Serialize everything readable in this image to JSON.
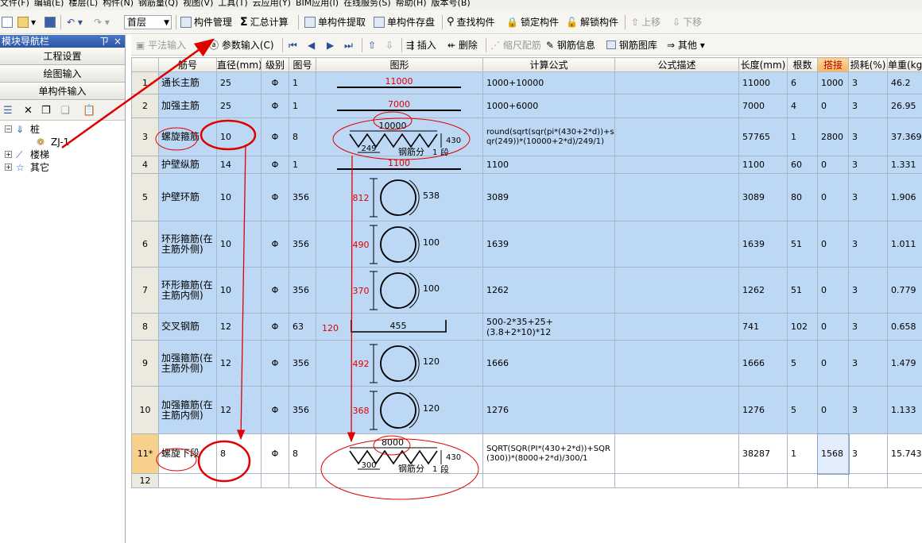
{
  "menu": [
    "文件(F)",
    "编辑(E)",
    "楼层(L)",
    "构件(N)",
    "钢筋量(Q)",
    "视图(V)",
    "工具(T)",
    "云应用(Y)",
    "BIM应用(I)",
    "在线服务(S)",
    "帮助(H)",
    "版本号(B)"
  ],
  "toolbar": {
    "floor_select": "首层",
    "component_manage": "构件管理",
    "sum_calc": "汇总计算",
    "extract": "单构件提取",
    "save_single": "单构件存盘",
    "find": "查找构件",
    "lock": "锁定构件",
    "unlock": "解锁构件",
    "move_up": "上移",
    "move_down": "下移"
  },
  "nav": {
    "title": "模块导航栏",
    "pin": "ㄗ",
    "close": "×",
    "buttons": [
      "工程设置",
      "绘图输入",
      "单构件输入"
    ],
    "tree": [
      {
        "label": "桩",
        "level": 0,
        "expand": "−"
      },
      {
        "label": "ZJ-1",
        "level": 1,
        "expand": ""
      },
      {
        "label": "楼梯",
        "level": 0,
        "expand": "+"
      },
      {
        "label": "其它",
        "level": 0,
        "expand": "+"
      }
    ]
  },
  "subtoolbar": {
    "flat_input": "平法输入",
    "param_input": "参数输入(C)",
    "insert": "插入",
    "delete": "删除",
    "scale_rebar": "缩尺配筋",
    "rebar_info": "钢筋信息",
    "rebar_lib": "钢筋图库",
    "other": "其他"
  },
  "table": {
    "headers": [
      "",
      "筋号",
      "直径(mm)",
      "级别",
      "图号",
      "图形",
      "计算公式",
      "公式描述",
      "长度(mm)",
      "根数",
      "搭接",
      "损耗(%)",
      "单重(kg)"
    ],
    "grade_symbol": "Φ",
    "rows": [
      {
        "n": "1",
        "name": "通长主筋",
        "dia": "25",
        "fig": "1",
        "formula": "1000+10000",
        "desc": "",
        "len": "11000",
        "count": "6",
        "lap": "1000",
        "loss": "3",
        "wt": "46.2",
        "shape": {
          "kind": "line",
          "label": "11000"
        }
      },
      {
        "n": "2",
        "name": "加强主筋",
        "dia": "25",
        "fig": "1",
        "formula": "1000+6000",
        "desc": "",
        "len": "7000",
        "count": "4",
        "lap": "0",
        "loss": "3",
        "wt": "26.95",
        "shape": {
          "kind": "line",
          "label": "7000"
        }
      },
      {
        "n": "3",
        "name": "螺旋箍筋",
        "dia": "10",
        "fig": "8",
        "formula": "round(sqrt(sqr(pi*(430+2*d))+sqr(249))*(10000+2*d)/249/1)",
        "desc": "",
        "len": "57765",
        "count": "1",
        "lap": "2800",
        "loss": "3",
        "wt": "37.369",
        "shape": {
          "kind": "spiral",
          "top": "10000",
          "pitch": "249",
          "height": "430",
          "seg_label": "钢筋分",
          "seg": "1",
          "seg_unit": "段"
        }
      },
      {
        "n": "4",
        "name": "护壁纵筋",
        "dia": "14",
        "fig": "1",
        "formula": "1100",
        "desc": "",
        "len": "1100",
        "count": "60",
        "lap": "0",
        "loss": "3",
        "wt": "1.331",
        "shape": {
          "kind": "line",
          "label": "1100"
        }
      },
      {
        "n": "5",
        "name": "护壁环筋",
        "dia": "10",
        "fig": "356",
        "formula": "3089",
        "desc": "",
        "len": "3089",
        "count": "80",
        "lap": "0",
        "loss": "3",
        "wt": "1.906",
        "shape": {
          "kind": "ring",
          "h": "812",
          "r": "538"
        }
      },
      {
        "n": "6",
        "name": "环形箍筋(在主筋外侧)",
        "dia": "10",
        "fig": "356",
        "formula": "1639",
        "desc": "",
        "len": "1639",
        "count": "51",
        "lap": "0",
        "loss": "3",
        "wt": "1.011",
        "shape": {
          "kind": "ring",
          "h": "490",
          "r": "100"
        }
      },
      {
        "n": "7",
        "name": "环形箍筋(在主筋内侧)",
        "dia": "10",
        "fig": "356",
        "formula": "1262",
        "desc": "",
        "len": "1262",
        "count": "51",
        "lap": "0",
        "loss": "3",
        "wt": "0.779",
        "shape": {
          "kind": "ring",
          "h": "370",
          "r": "100"
        }
      },
      {
        "n": "8",
        "name": "交叉钢筋",
        "dia": "12",
        "fig": "63",
        "formula": "500-2*35+25+(3.8+2*10)*12",
        "desc": "",
        "len": "741",
        "count": "102",
        "lap": "0",
        "loss": "3",
        "wt": "0.658",
        "shape": {
          "kind": "bracket",
          "side": "120",
          "label": "455"
        }
      },
      {
        "n": "9",
        "name": "加强箍筋(在主筋外侧)",
        "dia": "12",
        "fig": "356",
        "formula": "1666",
        "desc": "",
        "len": "1666",
        "count": "5",
        "lap": "0",
        "loss": "3",
        "wt": "1.479",
        "shape": {
          "kind": "ring",
          "h": "492",
          "r": "120"
        }
      },
      {
        "n": "10",
        "name": "加强箍筋(在主筋内侧)",
        "dia": "12",
        "fig": "356",
        "formula": "1276",
        "desc": "",
        "len": "1276",
        "count": "5",
        "lap": "0",
        "loss": "3",
        "wt": "1.133",
        "shape": {
          "kind": "ring",
          "h": "368",
          "r": "120"
        }
      },
      {
        "n": "11*",
        "name": "螺旋下段",
        "dia": "8",
        "fig": "8",
        "formula": "SQRT(SQR(PI*(430+2*d))+SQR(300))*(8000+2*d)/300/1",
        "desc": "",
        "len": "38287",
        "count": "1",
        "lap": "1568",
        "loss": "3",
        "wt": "15.743",
        "shape": {
          "kind": "spiral",
          "top": "8000",
          "pitch": "300",
          "height": "430",
          "seg_label": "钢筋分",
          "seg": "1",
          "seg_unit": "段"
        }
      },
      {
        "n": "12",
        "name": "",
        "dia": "",
        "fig": "",
        "formula": "",
        "desc": "",
        "len": "",
        "count": "",
        "lap": "",
        "loss": "",
        "wt": "",
        "shape": {
          "kind": "none"
        }
      }
    ]
  },
  "colors": {
    "row_blue": "#bdd8f4",
    "annotation_red": "#e00000",
    "current_row": "#f7d08b"
  }
}
